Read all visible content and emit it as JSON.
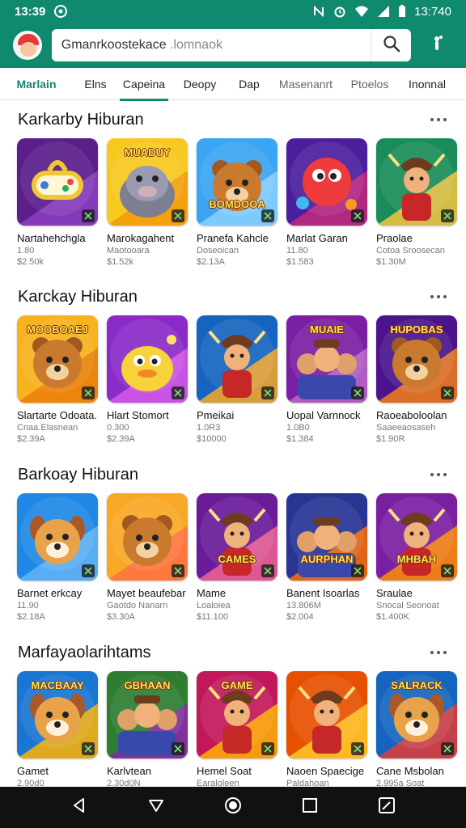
{
  "status": {
    "time": "13:39",
    "right_time": "13:740"
  },
  "search": {
    "text": "Gmanrkoostekace",
    "faded": " .lomnaok"
  },
  "tabs": [
    {
      "label": "Marlain"
    },
    {
      "label": "Elns"
    },
    {
      "label": "Capeina"
    },
    {
      "label": "Deopy"
    },
    {
      "label": "Dap"
    },
    {
      "label": "Masenanrt"
    },
    {
      "label": "Ptoelos"
    },
    {
      "label": "Inonnal"
    }
  ],
  "sections": [
    {
      "title": "Karkarby Hiburan",
      "cards": [
        {
          "name": "Nartahehchgla",
          "sub": "1.80",
          "price": "$2.50k",
          "tile_text": "",
          "colors": [
            "#5b1e8a",
            "#8d3fc4"
          ],
          "art": "gamepad"
        },
        {
          "name": "Marokagahent",
          "sub": "Maotooara",
          "price": "$1.52k",
          "tile_text": "MUADUY",
          "colors": [
            "#f7c81e",
            "#f29a0a"
          ],
          "art": "hippo"
        },
        {
          "name": "Pranefa Kahcle",
          "sub": "Doseoican",
          "price": "$2.13A",
          "tile_text": "BOMDOOA",
          "colors": [
            "#3aa5f2",
            "#8ad0ff"
          ],
          "art": "bear"
        },
        {
          "name": "Marlat Garan",
          "sub": "11.80",
          "price": "$1.583",
          "tile_text": "",
          "colors": [
            "#4b1e9e",
            "#c22a7a"
          ],
          "art": "blob"
        },
        {
          "name": "Praolae",
          "sub": "Cotoa Sroosecan",
          "price": "$1.30M",
          "tile_text": "",
          "colors": [
            "#1a8c5a",
            "#f5c542"
          ],
          "art": "hero"
        }
      ]
    },
    {
      "title": "Karckay Hiburan",
      "cards": [
        {
          "name": "Slartarte Odoata.",
          "sub": "Cnaa.Elasnean",
          "price": "$2.39A",
          "tile_text": "MOOBOAEJ",
          "colors": [
            "#f7b21e",
            "#e97d0b"
          ],
          "art": "bear"
        },
        {
          "name": "Hlart Stomort",
          "sub": "0.300",
          "price": "$2.39A",
          "tile_text": "",
          "colors": [
            "#8a2bc9",
            "#d35ae8"
          ],
          "art": "duck"
        },
        {
          "name": "Pmeikai",
          "sub": "1.0R3",
          "price": "$10000",
          "tile_text": "",
          "colors": [
            "#1565c0",
            "#f9a825"
          ],
          "art": "hero"
        },
        {
          "name": "Uopal Varnnock",
          "sub": "1.0B0",
          "price": "$1.384",
          "tile_text": "MUAIE",
          "colors": [
            "#7b1fa2",
            "#ba68c8"
          ],
          "art": "crowd"
        },
        {
          "name": "Raoeaboloolan",
          "sub": "Saaeeaosaseh",
          "price": "$1.90R",
          "tile_text": "HUPOBAS",
          "colors": [
            "#4a148c",
            "#f57f17"
          ],
          "art": "bear"
        }
      ]
    },
    {
      "title": "Barkoay Hiburan",
      "cards": [
        {
          "name": "Barnet erkcay",
          "sub": "11.90",
          "price": "$2.18A",
          "tile_text": "",
          "colors": [
            "#1e88e5",
            "#64b5f6"
          ],
          "art": "dog"
        },
        {
          "name": "Mayet beaufebar",
          "sub": "Gaotdo Nanarn",
          "price": "$3.30A",
          "tile_text": "",
          "colors": [
            "#f9a825",
            "#ff7043"
          ],
          "art": "bear"
        },
        {
          "name": "Mame",
          "sub": "Loaloiea",
          "price": "$11.100",
          "tile_text": "CAMES",
          "colors": [
            "#6a1b9a",
            "#f06292"
          ],
          "art": "hero"
        },
        {
          "name": "Banent Isoarlas",
          "sub": "13.806M",
          "price": "$2.004",
          "tile_text": "AURPHAN",
          "colors": [
            "#283593",
            "#ff6f00"
          ],
          "art": "crowd"
        },
        {
          "name": "Sraulae",
          "sub": "Snocal Seonoat",
          "price": "$1.400K",
          "tile_text": "MHBAH",
          "colors": [
            "#7b1fa2",
            "#ff8f00"
          ],
          "art": "hero"
        }
      ]
    },
    {
      "title": "Marfayaolarihtams",
      "cards": [
        {
          "name": "Gamet",
          "sub": "2.90d0",
          "price": "",
          "tile_text": "MACBAAY",
          "colors": [
            "#1976d2",
            "#ffb300"
          ],
          "art": "dog"
        },
        {
          "name": "Karlvtean",
          "sub": "2.30d0N",
          "price": "",
          "tile_text": "GBHAAN",
          "colors": [
            "#2e7d32",
            "#8e24aa"
          ],
          "art": "crowd"
        },
        {
          "name": "Hemel Soat",
          "sub": "Earaloleen",
          "price": "",
          "tile_text": "GAME",
          "colors": [
            "#c2185b",
            "#ffb300"
          ],
          "art": "hero"
        },
        {
          "name": "Naoen Spaecige",
          "sub": "Paldahoan",
          "price": "",
          "tile_text": "",
          "colors": [
            "#e65100",
            "#ffca28"
          ],
          "art": "hero"
        },
        {
          "name": "Cane Msbolan",
          "sub": "2.995a Soat",
          "price": "",
          "tile_text": "SALRACK",
          "colors": [
            "#1565c0",
            "#e53935"
          ],
          "art": "dog"
        }
      ]
    }
  ]
}
